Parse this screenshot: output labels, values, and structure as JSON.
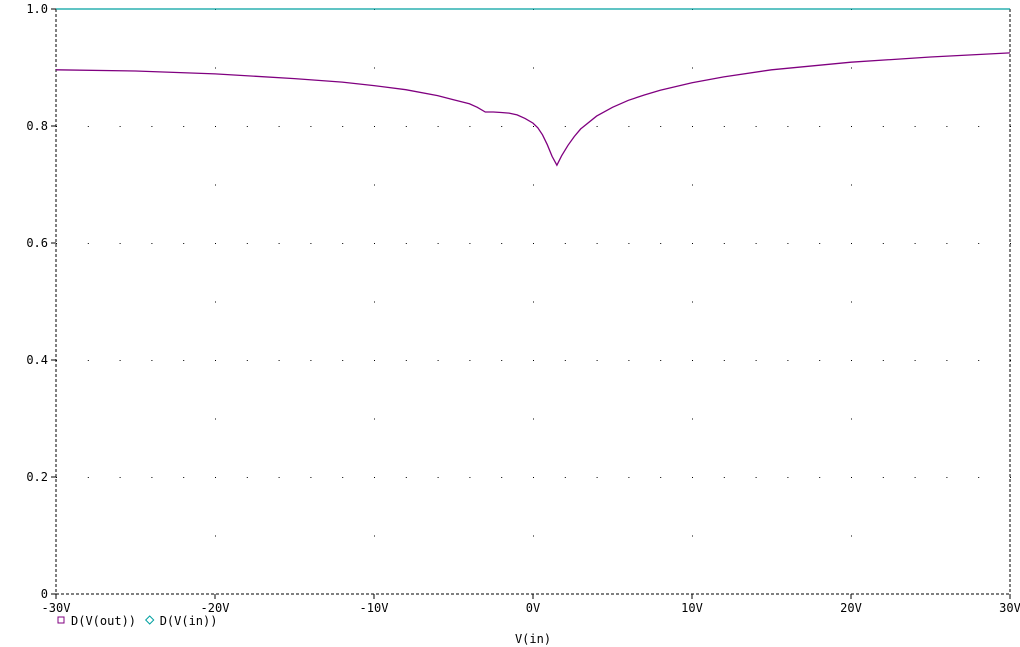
{
  "chart_data": {
    "type": "line",
    "xlabel": "V(in)",
    "xlim": [
      -30,
      30
    ],
    "ylim": [
      0,
      1.0
    ],
    "grid": "dotted",
    "legend_placement": "bottom-left",
    "xticks": [
      {
        "value": -30,
        "label": "-30V"
      },
      {
        "value": -20,
        "label": "-20V"
      },
      {
        "value": -10,
        "label": "-10V"
      },
      {
        "value": 0,
        "label": "0V"
      },
      {
        "value": 10,
        "label": "10V"
      },
      {
        "value": 20,
        "label": "20V"
      },
      {
        "value": 30,
        "label": "30V"
      }
    ],
    "yticks": [
      {
        "value": 0,
        "label": "0"
      },
      {
        "value": 0.2,
        "label": "0.2"
      },
      {
        "value": 0.4,
        "label": "0.4"
      },
      {
        "value": 0.6,
        "label": "0.6"
      },
      {
        "value": 0.8,
        "label": "0.8"
      },
      {
        "value": 1.0,
        "label": "1.0"
      }
    ],
    "series": [
      {
        "name": "D(V(out))",
        "color": "#800080",
        "marker": "square",
        "x": [
          -30,
          -25,
          -20,
          -15,
          -12,
          -10,
          -8,
          -6,
          -5,
          -4,
          -3.5,
          -3,
          -2.5,
          -2,
          -1.5,
          -1,
          -0.5,
          0,
          0.3,
          0.6,
          0.9,
          1.2,
          1.5,
          1.8,
          2.2,
          2.6,
          3,
          4,
          5,
          6,
          7,
          8,
          10,
          12,
          15,
          20,
          25,
          30
        ],
        "y": [
          0.896,
          0.894,
          0.889,
          0.881,
          0.875,
          0.869,
          0.862,
          0.852,
          0.845,
          0.838,
          0.832,
          0.824,
          0.824,
          0.823,
          0.822,
          0.819,
          0.813,
          0.805,
          0.797,
          0.785,
          0.768,
          0.748,
          0.733,
          0.749,
          0.767,
          0.782,
          0.795,
          0.817,
          0.832,
          0.844,
          0.853,
          0.861,
          0.874,
          0.884,
          0.896,
          0.909,
          0.918,
          0.925
        ]
      },
      {
        "name": "D(V(in))",
        "color": "#00a0a0",
        "marker": "diamond",
        "x": [
          -30,
          30
        ],
        "y": [
          1.0,
          1.0
        ]
      }
    ]
  }
}
